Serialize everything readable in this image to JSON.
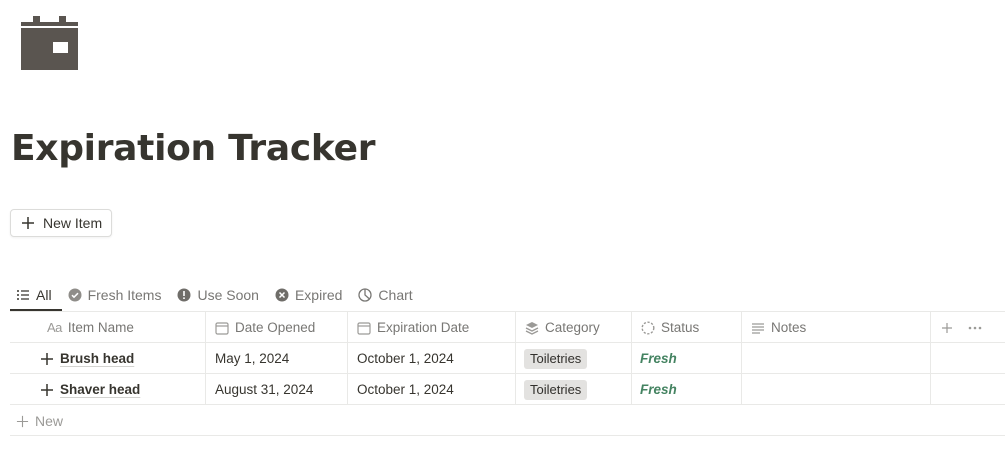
{
  "page": {
    "icon": "calendar-icon",
    "title": "Expiration Tracker",
    "new_item_label": "New Item"
  },
  "tabs": [
    {
      "label": "All",
      "icon": "list-icon",
      "active": true
    },
    {
      "label": "Fresh Items",
      "icon": "check-circle-icon"
    },
    {
      "label": "Use Soon",
      "icon": "exclamation-circle-icon"
    },
    {
      "label": "Expired",
      "icon": "x-circle-icon"
    },
    {
      "label": "Chart",
      "icon": "pie-chart-icon"
    }
  ],
  "table": {
    "columns": [
      {
        "label": "Item Name",
        "icon": "title-aa-icon",
        "prefix": "Aa"
      },
      {
        "label": "Date Opened",
        "icon": "calendar-icon"
      },
      {
        "label": "Expiration Date",
        "icon": "calendar-icon"
      },
      {
        "label": "Category",
        "icon": "layers-icon"
      },
      {
        "label": "Status",
        "icon": "status-circle-icon"
      },
      {
        "label": "Notes",
        "icon": "text-lines-icon"
      }
    ],
    "rows": [
      {
        "name": "Brush head",
        "date_opened": "May 1, 2024",
        "expiration_date": "October 1, 2024",
        "category": "Toiletries",
        "status": "Fresh",
        "notes": ""
      },
      {
        "name": "Shaver head",
        "date_opened": "August 31, 2024",
        "expiration_date": "October 1, 2024",
        "category": "Toiletries",
        "status": "Fresh",
        "notes": ""
      }
    ],
    "new_row_label": "New"
  },
  "colors": {
    "text": "#37352f",
    "muted": "#787774",
    "status_fresh": "#448361",
    "tag_bg": "#e3e2e0",
    "icon_fill": "#5a5550"
  }
}
